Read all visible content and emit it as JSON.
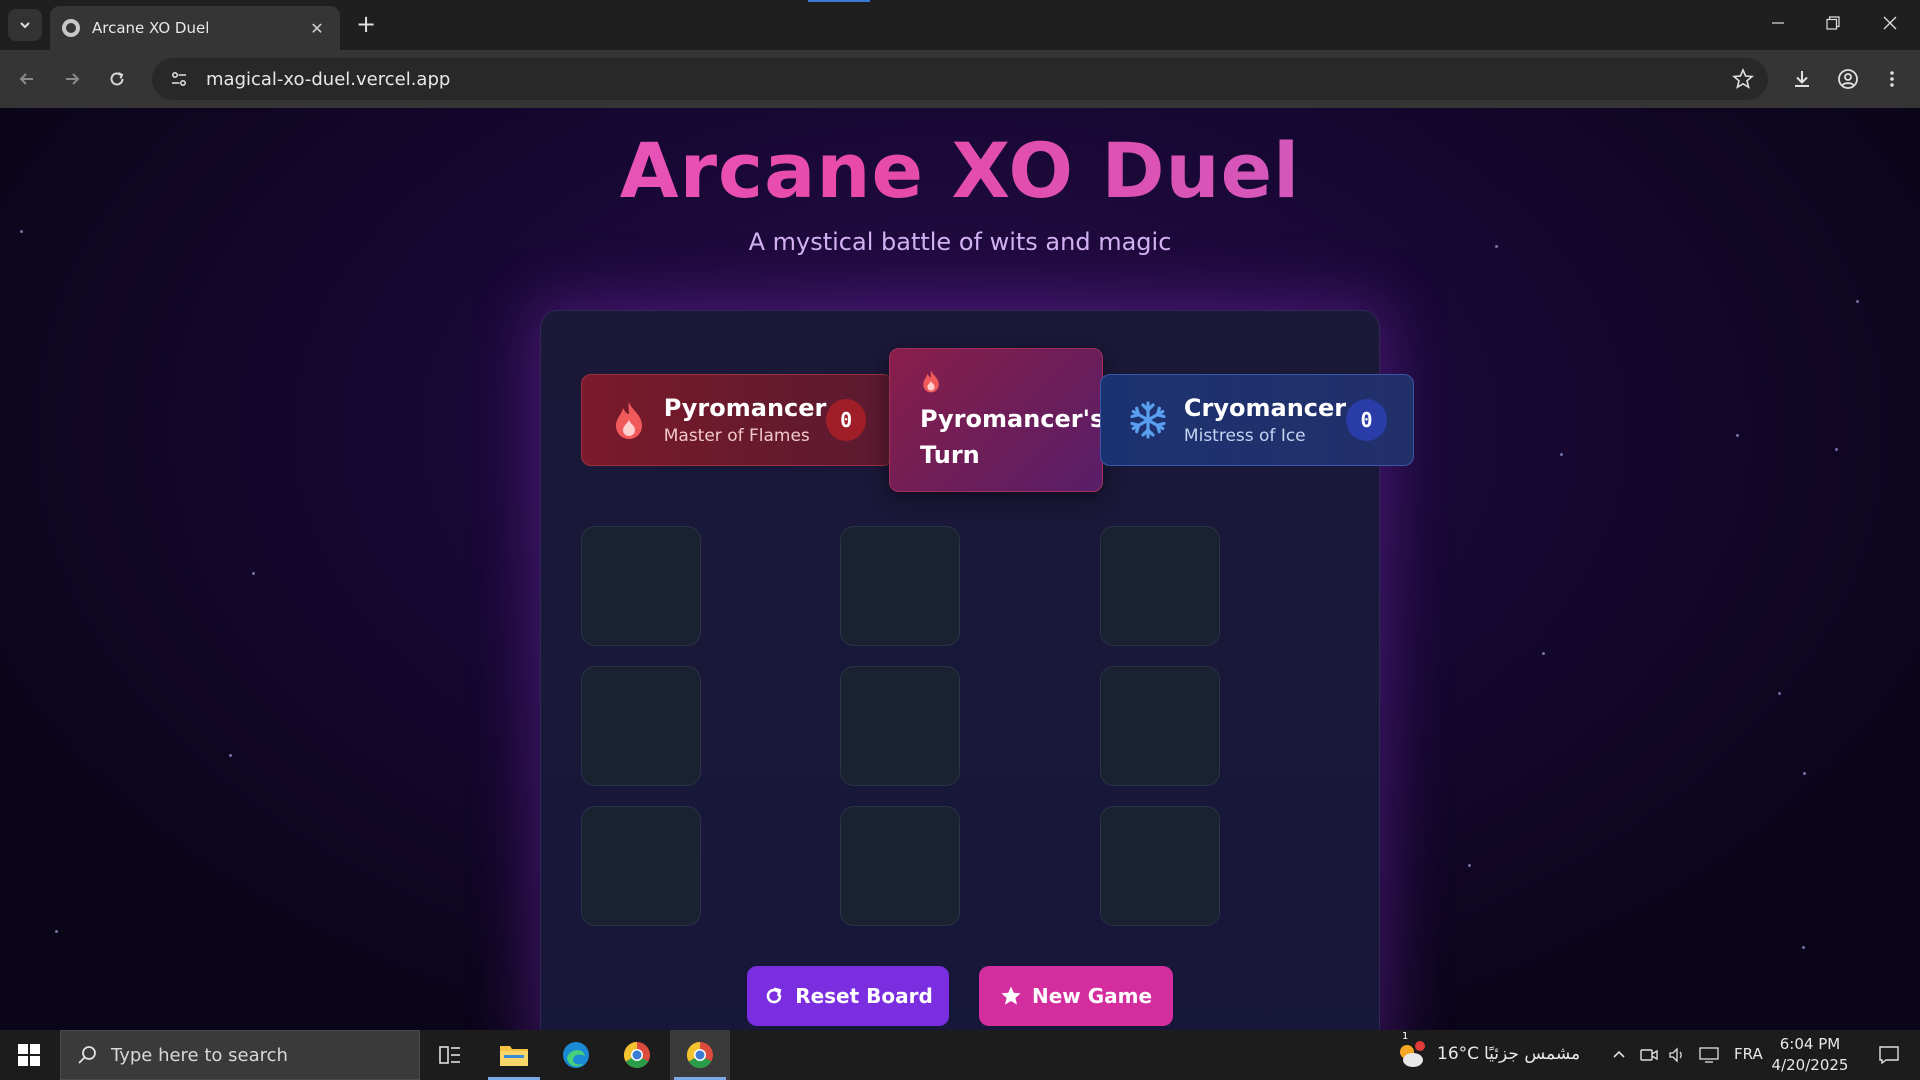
{
  "browser": {
    "tab_title": "Arcane XO Duel",
    "tab_close": "✕",
    "new_tab": "+",
    "url": "magical-xo-duel.vercel.app",
    "window_controls": [
      "minimize",
      "restore",
      "close"
    ]
  },
  "page": {
    "title": "Arcane XO Duel",
    "subtitle": "A mystical battle of wits and magic",
    "players": {
      "pyro": {
        "name": "Pyromancer",
        "subtitle": "Master of Flames",
        "score": "0",
        "icon": "flame-icon",
        "color": "#f05a5a"
      },
      "cryo": {
        "name": "Cryomancer",
        "subtitle": "Mistress of Ice",
        "score": "0",
        "icon": "snowflake-icon",
        "color": "#5aa0f0"
      }
    },
    "turn": {
      "text": "Pyromancer's Turn",
      "icon": "flame-icon"
    },
    "board": [
      "",
      "",
      "",
      "",
      "",
      "",
      "",
      "",
      ""
    ],
    "buttons": {
      "reset": {
        "label": "Reset Board",
        "icon": "refresh-icon",
        "color": "#7a2ee0"
      },
      "new_game": {
        "label": "New Game",
        "icon": "star-icon",
        "color": "#d42d9e"
      }
    }
  },
  "taskbar": {
    "search_placeholder": "Type here to search",
    "weather_temp": "16°C",
    "weather_location": "مشمس جزئيًا",
    "language": "FRA",
    "time": "6:04 PM",
    "date": "4/20/2025",
    "weather_badge": "1"
  }
}
